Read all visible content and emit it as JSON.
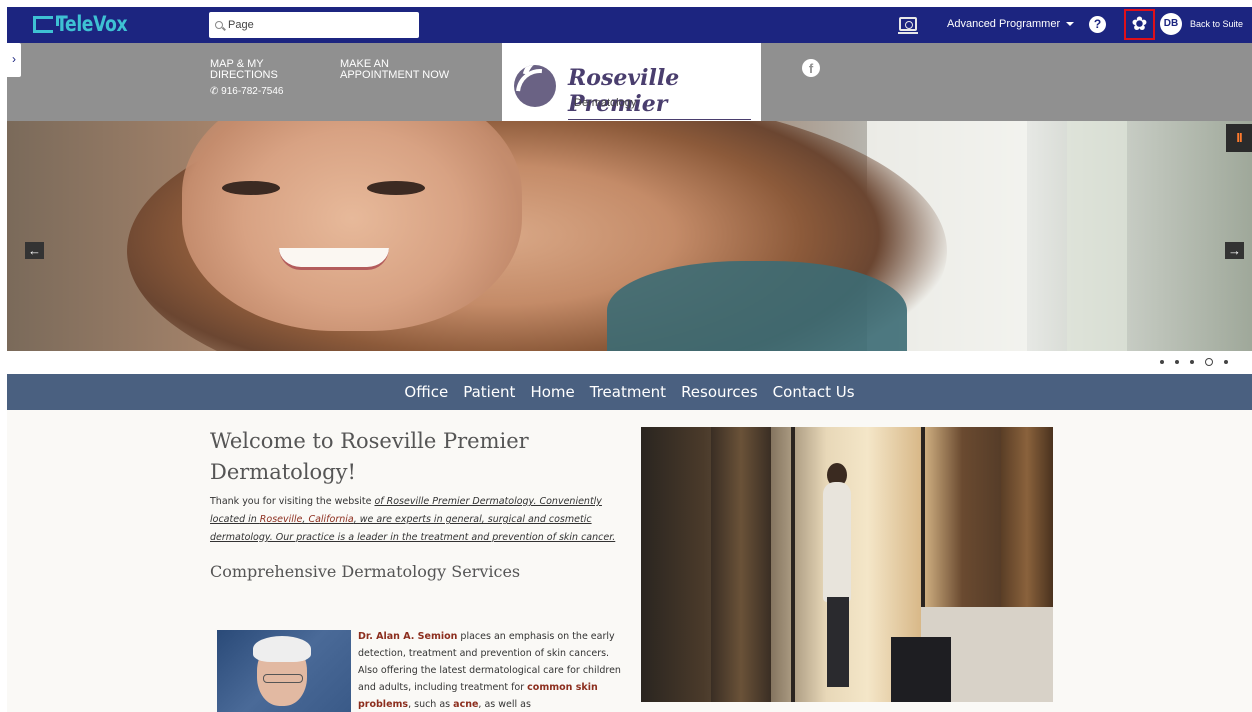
{
  "app": {
    "logo": "TeleVox",
    "search": {
      "value": "Page",
      "placeholder": "Page"
    },
    "role_label": "Advanced Programmer",
    "help_label": "?",
    "avatar_initials": "DB",
    "back_label": "Back to Suite",
    "icons": [
      "preview-icon",
      "help-icon",
      "gear-icon",
      "chevron-right-icon"
    ]
  },
  "site": {
    "header": {
      "map_label": "MAP & MY DIRECTIONS",
      "appointment_label": "MAKE AN APPOINTMENT NOW",
      "phone": "916-782-7546",
      "logo_name": "Roseville Premier",
      "logo_sub": "Dermatology",
      "facebook": "f"
    },
    "hero": {
      "prev": "←",
      "next": "→",
      "pause": "II",
      "dots": [
        false,
        false,
        false,
        true,
        false
      ]
    },
    "nav": [
      "Office",
      "Patient",
      "Home",
      "Treatment",
      "Resources",
      "Contact Us"
    ],
    "content": {
      "welcome_title": "Welcome to Roseville Premier Dermatology!",
      "intro_lead": "Thank you for visiting the website ",
      "intro_link_1": "of Roseville Premier Dermatology. Conveniently located in ",
      "intro_city": "Roseville",
      "intro_comma": ", ",
      "intro_state": "California",
      "intro_link_2": ", we are experts in general, surgical and cosmetic dermatology. Our practice is a leader in the treatment and prevention of skin cancer.",
      "services_title": "Comprehensive Dermatology Services",
      "doctor_name": "Dr. Alan A. Semion",
      "doctor_text": " places an emphasis on the early detection, treatment and prevention of skin cancers. Also offering the latest dermatological care for children and adults, including treatment for ",
      "doctor_link_1": "common skin problems",
      "doctor_text_2": ", such as ",
      "doctor_link_2": "acne",
      "doctor_text_3": ", as well as"
    }
  },
  "colors": {
    "topbar": "#1c2580",
    "logo_accent": "#3ec1d3",
    "header_gray": "#909090",
    "nav_bg": "#4a6080",
    "highlight_box": "#e0101a",
    "link_red": "#8c2e1e"
  }
}
